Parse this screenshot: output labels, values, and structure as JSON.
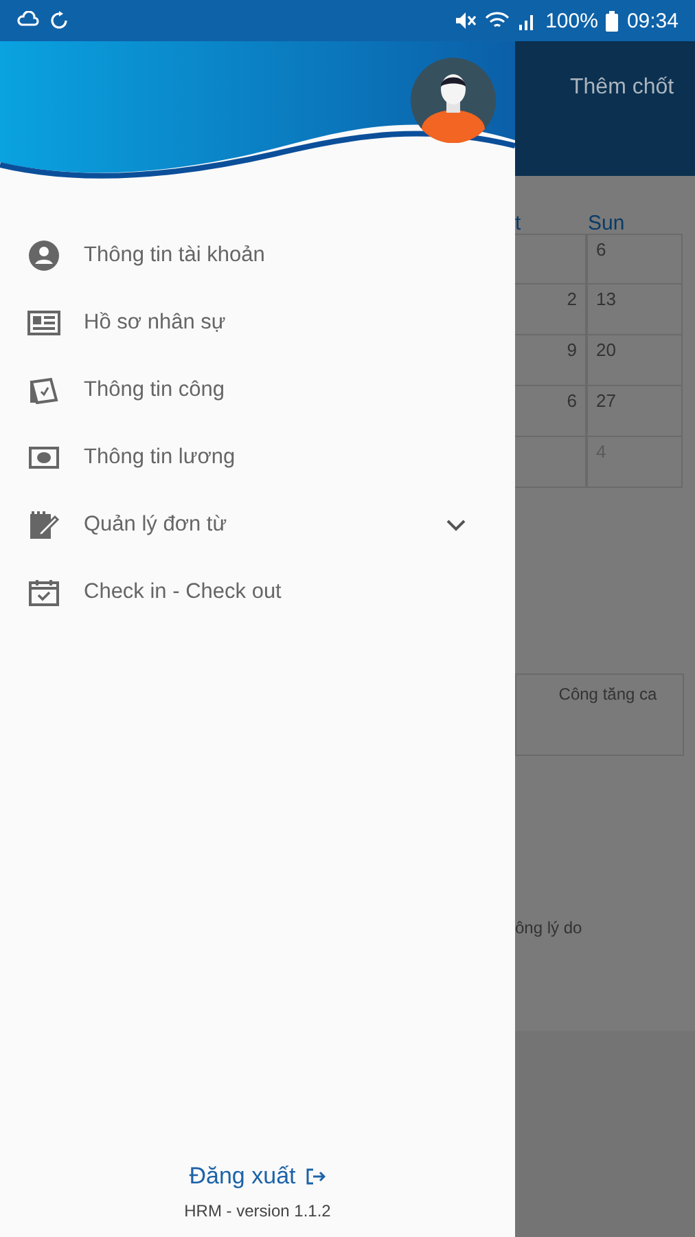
{
  "status_bar": {
    "battery": "100%",
    "time": "09:34"
  },
  "drawer": {
    "menu": [
      {
        "kind": "account",
        "label": "Thông tin tài khoản"
      },
      {
        "kind": "profile",
        "label": "Hồ sơ nhân sự"
      },
      {
        "kind": "timesheet",
        "label": "Thông tin công"
      },
      {
        "kind": "salary",
        "label": "Thông tin lương"
      },
      {
        "kind": "requests",
        "label": "Quản lý đơn từ",
        "submenu": {
          "expanded": false
        }
      },
      {
        "kind": "checkin",
        "label": "Check in - Check out"
      }
    ],
    "logout": "Đăng xuất",
    "version": "HRM - version 1.1.2"
  },
  "background": {
    "header_action": "Thêm chốt",
    "calendar": {
      "columns": [
        "t",
        "Sun"
      ],
      "rows": [
        {
          "sun": "6",
          "muted": false
        },
        {
          "column_1": "2",
          "sun": "13",
          "muted": false
        },
        {
          "column_1": "9",
          "sun": "20",
          "muted": false
        },
        {
          "column_1": "6",
          "sun": "27",
          "muted": false
        },
        {
          "sun": "4",
          "muted": true
        }
      ]
    },
    "card_label": "Công tăng ca",
    "note": "ông lý do"
  }
}
